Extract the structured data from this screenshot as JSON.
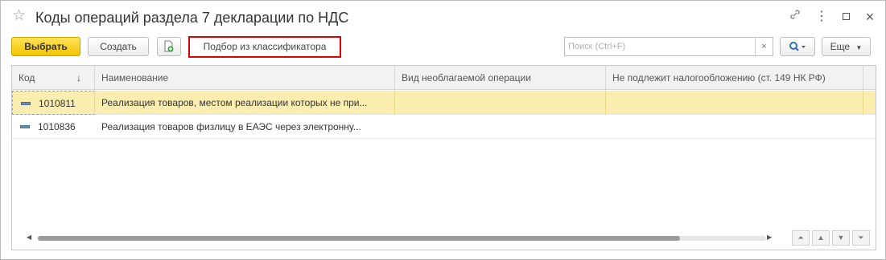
{
  "window": {
    "title": "Коды операций раздела 7 декларации по НДС"
  },
  "toolbar": {
    "select_label": "Выбрать",
    "create_label": "Создать",
    "pick_label": "Подбор из классификатора",
    "search_placeholder": "Поиск (Ctrl+F)",
    "clear_label": "×",
    "search_icon": "search-icon",
    "more_label": "Еще"
  },
  "table": {
    "columns": [
      {
        "label": "Код"
      },
      {
        "label": "Наименование"
      },
      {
        "label": "Вид необлагаемой операции"
      },
      {
        "label": "Не подлежит налогообложению (ст. 149 НК РФ)"
      }
    ],
    "rows": [
      {
        "code": "1010811",
        "name": "Реализация товаров, местом реализации которых не при...",
        "vid": "",
        "np": ""
      },
      {
        "code": "1010836",
        "name": "Реализация товаров физлицу в ЕАЭС через электронну...",
        "vid": "",
        "np": ""
      }
    ]
  },
  "colors": {
    "primary_button": "#f2c500",
    "selected_row": "#fbeeb0",
    "highlight_border": "#e00000"
  }
}
